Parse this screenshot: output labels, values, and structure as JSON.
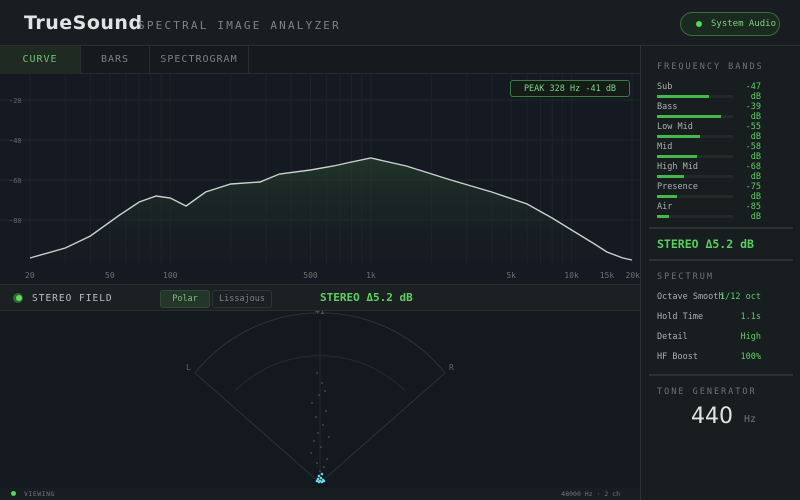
{
  "app": {
    "title": "TrueSound",
    "subtitle": "SPECTRAL IMAGE ANALYZER",
    "audio_source": "System Audio"
  },
  "tabs": [
    {
      "label": "CURVE",
      "active": true
    },
    {
      "label": "BARS",
      "active": false
    },
    {
      "label": "SPECTROGRAM",
      "active": false
    }
  ],
  "spectrum": {
    "peak_badge": "PEAK 328 Hz -41 dB",
    "y_ticks": [
      "-20",
      "-40",
      "-60",
      "-80"
    ],
    "x_ticks": [
      "20",
      "50",
      "100",
      "500",
      "1k",
      "5k",
      "10k",
      "15k",
      "20k"
    ]
  },
  "chart_data": {
    "type": "area",
    "title": "",
    "xlabel": "",
    "ylabel": "",
    "y_ticks": [
      -20,
      -40,
      -60,
      -80
    ],
    "x_ticks": [
      "20",
      "50",
      "100",
      "500",
      "1k",
      "5k",
      "10k",
      "15k",
      "20k"
    ],
    "ylim": [
      -100,
      -10
    ],
    "grid": true,
    "series": [
      {
        "values": [
          {
            "x": 20,
            "y": -99
          },
          {
            "x": 30,
            "y": -94
          },
          {
            "x": 40,
            "y": -88
          },
          {
            "x": 55,
            "y": -78
          },
          {
            "x": 70,
            "y": -71
          },
          {
            "x": 85,
            "y": -68
          },
          {
            "x": 100,
            "y": -69
          },
          {
            "x": 120,
            "y": -73
          },
          {
            "x": 150,
            "y": -66
          },
          {
            "x": 200,
            "y": -62
          },
          {
            "x": 280,
            "y": -61
          },
          {
            "x": 350,
            "y": -57
          },
          {
            "x": 500,
            "y": -55
          },
          {
            "x": 650,
            "y": -53
          },
          {
            "x": 800,
            "y": -51
          },
          {
            "x": 1000,
            "y": -49
          },
          {
            "x": 1500,
            "y": -53
          },
          {
            "x": 2500,
            "y": -60
          },
          {
            "x": 4000,
            "y": -66
          },
          {
            "x": 6000,
            "y": -72
          },
          {
            "x": 8000,
            "y": -79
          },
          {
            "x": 10000,
            "y": -85
          },
          {
            "x": 13000,
            "y": -92
          },
          {
            "x": 15000,
            "y": -96
          },
          {
            "x": 18000,
            "y": -99
          },
          {
            "x": 20000,
            "y": -100
          }
        ]
      }
    ]
  },
  "stereo": {
    "label": "STEREO FIELD",
    "modes": [
      {
        "label": "Polar",
        "active": true
      },
      {
        "label": "Lissajous",
        "active": false
      }
    ],
    "delta": "STEREO Δ5.2 dB",
    "polar_top": "+1",
    "polar_left": "L",
    "polar_right": "R"
  },
  "status": {
    "left": "VIEWING",
    "right": "48000 Hz · 2 ch"
  },
  "panel": {
    "bands_title": "FREQUENCY BANDS",
    "bands": [
      {
        "name": "Sub",
        "value": "-47 dB",
        "level": 0.68
      },
      {
        "name": "Bass",
        "value": "-39 dB",
        "level": 0.84
      },
      {
        "name": "Low Mid",
        "value": "-55 dB",
        "level": 0.57
      },
      {
        "name": "Mid",
        "value": "-58 dB",
        "level": 0.52
      },
      {
        "name": "High Mid",
        "value": "-68 dB",
        "level": 0.36
      },
      {
        "name": "Presence",
        "value": "-75 dB",
        "level": 0.26
      },
      {
        "name": "Air",
        "value": "-85 dB",
        "level": 0.16
      }
    ],
    "stereo_delta": "STEREO Δ5.2 dB",
    "spectrum_title": "SPECTRUM",
    "settings": [
      {
        "label": "Octave Smooth",
        "value": "1/12 oct"
      },
      {
        "label": "Hold Time",
        "value": "1.1s"
      },
      {
        "label": "Detail",
        "value": "High"
      },
      {
        "label": "HF Boost",
        "value": "100%"
      }
    ],
    "tone_title": "TONE GENERATOR",
    "tone_value": "440",
    "tone_unit": "Hz"
  },
  "colors": {
    "accent": "#56d45c",
    "curve": "#c9d1cc",
    "background": "#12161e",
    "panel": "#181d20"
  }
}
